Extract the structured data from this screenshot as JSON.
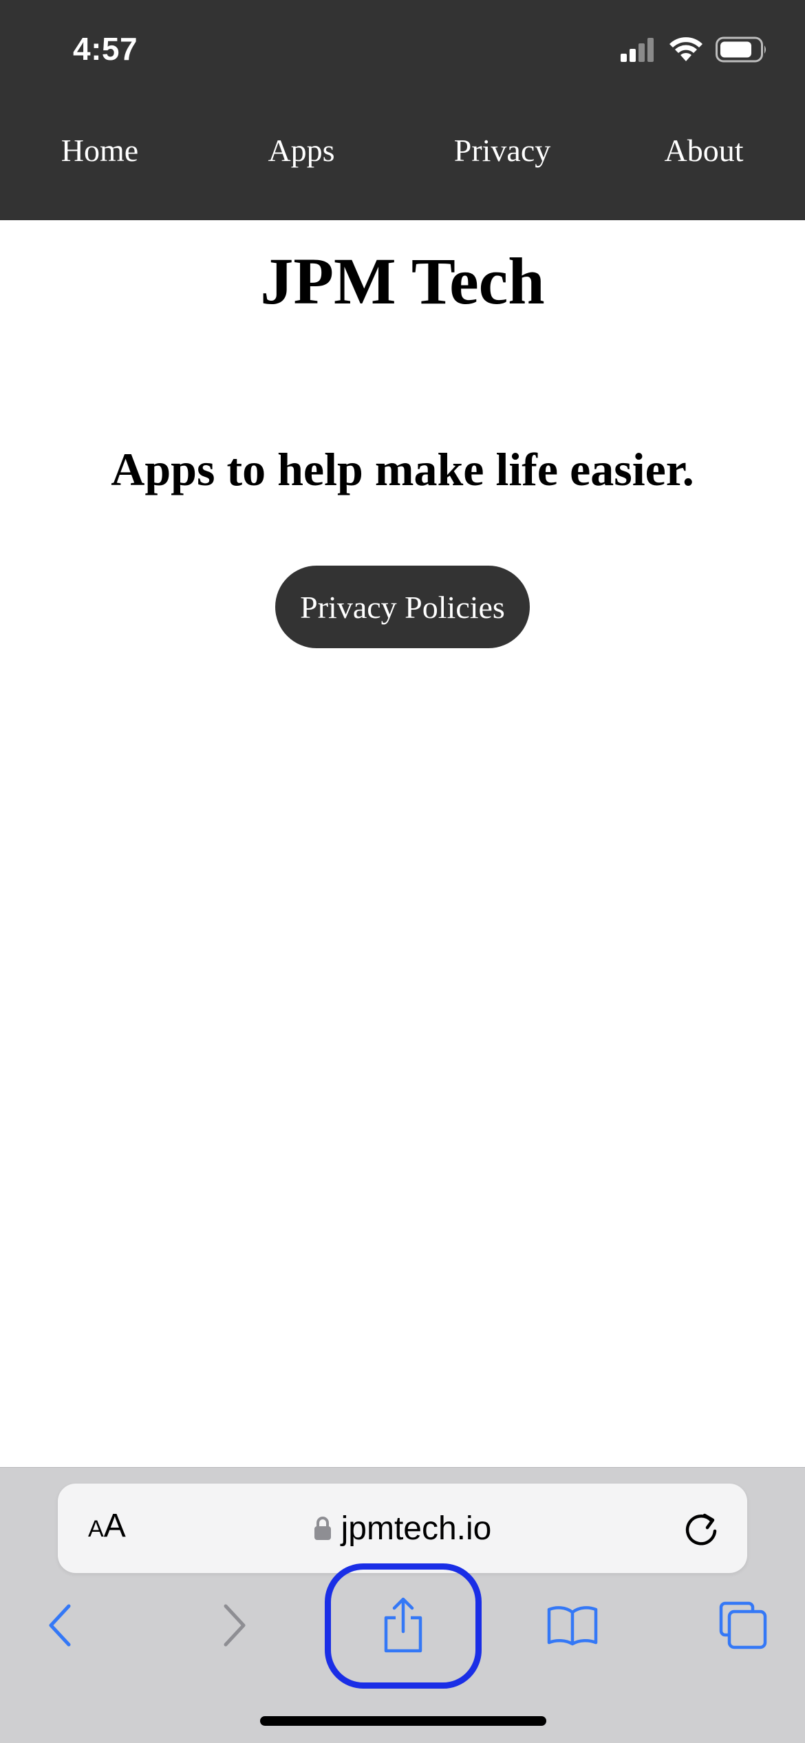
{
  "status_bar": {
    "time": "4:57",
    "icons": [
      "cellular-signal-icon",
      "wifi-icon",
      "battery-icon"
    ]
  },
  "nav": {
    "items": [
      {
        "label": "Home"
      },
      {
        "label": "Apps"
      },
      {
        "label": "Privacy"
      },
      {
        "label": "About"
      }
    ]
  },
  "main": {
    "title": "JPM Tech",
    "tagline": "Apps to help make life easier.",
    "cta_label": "Privacy Policies"
  },
  "browser": {
    "text_size_small": "A",
    "text_size_large": "A",
    "url": "jpmtech.io",
    "toolbar": [
      "back-icon",
      "forward-icon",
      "share-icon",
      "bookmarks-icon",
      "tabs-icon"
    ]
  },
  "colors": {
    "header_bg": "#333333",
    "button_bg": "#333333",
    "toolbar_accent": "#3478f6",
    "toolbar_disabled": "#8e8e93",
    "highlight_ring": "#1a2ee6"
  }
}
